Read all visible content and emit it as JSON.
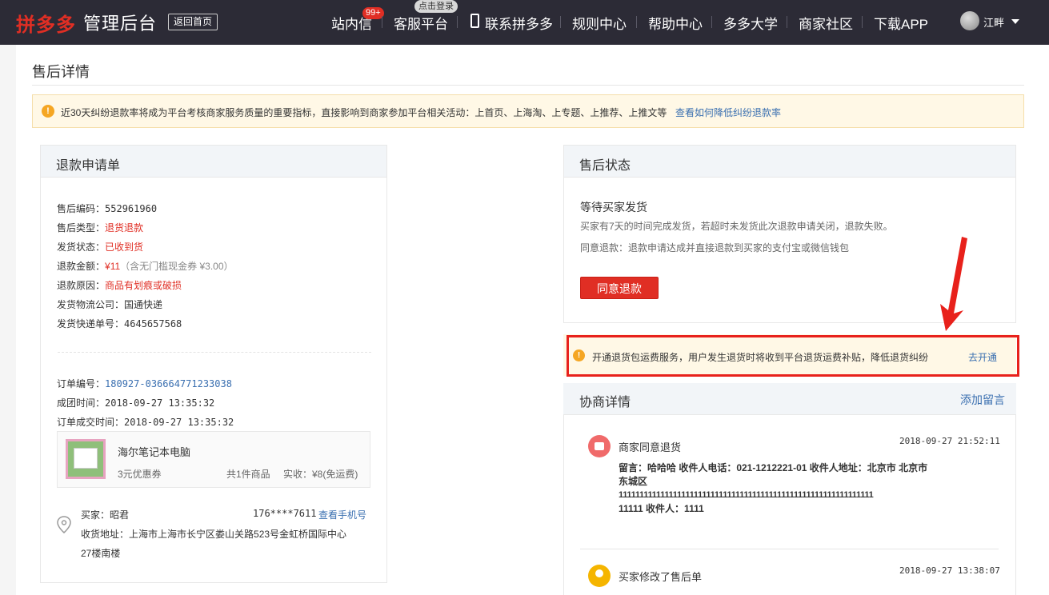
{
  "header": {
    "logo": "拼多多",
    "logo_sub": "管理后台",
    "back_home": "返回首页",
    "nav": {
      "inbox": "站内信",
      "inbox_badge": "99+",
      "service": "客服平台",
      "service_badge": "点击登录",
      "contact": "联系拼多多",
      "rules": "规则中心",
      "help": "帮助中心",
      "university": "多多大学",
      "community": "商家社区",
      "download": "下载APP"
    },
    "user": "江畔"
  },
  "page": {
    "title": "售后详情",
    "warning": "近30天纠纷退款率将成为平台考核商家服务质量的重要指标，直接影响到商家参加平台相关活动：上首页、上海淘、上专题、上推荐、上推文等",
    "warning_link": "查看如何降低纠纷退款率"
  },
  "refund": {
    "title": "退款申请单",
    "rows": {
      "code_label": "售后编码：",
      "code": "552961960",
      "type_label": "售后类型：",
      "type": "退货退款",
      "ship_label": "发货状态：",
      "ship": "已收到货",
      "amount_label": "退款金额：",
      "amount": "¥11",
      "amount_note": "（含无门槛现金券 ¥3.00）",
      "reason_label": "退款原因：",
      "reason": "商品有划痕或破损",
      "company_label": "发货物流公司：",
      "company": "国通快递",
      "tracking_label": "发货快递单号：",
      "tracking": "4645657568"
    },
    "order": {
      "no_label": "订单编号：",
      "no": "180927-036664771233038",
      "group_label": "成团时间：",
      "group": "2018-09-27 13:35:32",
      "deal_label": "订单成交时间：",
      "deal": "2018-09-27 13:35:32"
    },
    "product": {
      "name": "海尔笔记本电脑",
      "coupon": "3元优惠券",
      "count": "共1件商品",
      "paid": "实收：¥8(免运费)"
    },
    "buyer": {
      "label": "买家：",
      "name": "昭君",
      "phone": "176****7611",
      "phone_link": "查看手机号",
      "addr_label": "收货地址：",
      "addr1": "上海市上海市长宁区娄山关路523号金虹桥国际中心",
      "addr2": "27楼南楼"
    }
  },
  "status": {
    "title": "售后状态",
    "heading": "等待买家发货",
    "desc": "买家有7天的时间完成发货，若超时未发货此次退款申请关闭，退款失败。",
    "agree_note": "同意退款：退款申请达成并直接退款到买家的支付宝或微信钱包",
    "agree_button": "同意退款"
  },
  "notice": {
    "text": "开通退货包运费服务，用户发生退货时将收到平台退货运费补贴，降低退货纠纷",
    "link": "去开通"
  },
  "negotiation": {
    "title": "协商详情",
    "add_link": "添加留言",
    "messages": [
      {
        "title": "商家同意退货",
        "time": "2018-09-27 21:52:11",
        "line1": "留言：哈哈哈 收件人电话：021-1212221-01 收件人地址：北京市 北京市",
        "line2": "东城区",
        "line3": "1111111111111111111111111111111111111111111111111111111111111",
        "line4": "11111 收件人：1111"
      },
      {
        "title": "买家修改了售后单",
        "time": "2018-09-27 13:38:07"
      }
    ]
  },
  "colors": {
    "topbar": "#2c2b36",
    "brand_red": "#e02e24",
    "link_blue": "#3a6fb0",
    "warn_bg": "#fff8e6"
  }
}
